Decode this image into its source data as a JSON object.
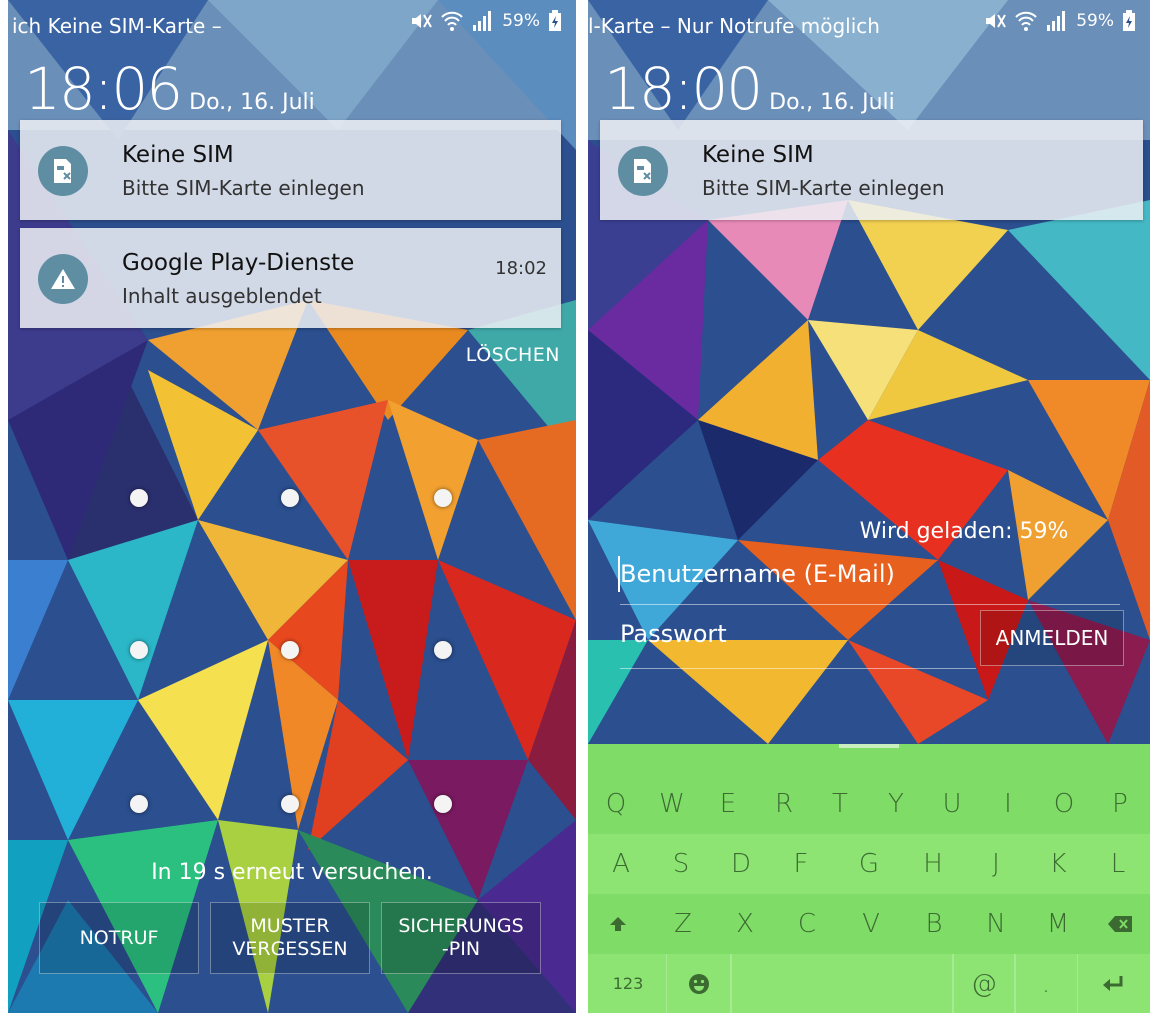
{
  "left_screen": {
    "status": {
      "carrier": "ich     Keine SIM-Karte –",
      "battery": "59%"
    },
    "clock": {
      "time": "18:06",
      "date": "Do., 16. Juli"
    },
    "notifications": [
      {
        "title": "Keine SIM",
        "text": "Bitte SIM-Karte einlegen",
        "time": ""
      },
      {
        "title": "Google Play-Dienste",
        "text": "Inhalt ausgeblendet",
        "time": "18:02"
      }
    ],
    "clear_label": "LÖSCHEN",
    "retry_message": "In 19 s erneut versuchen.",
    "buttons": {
      "emergency": "NOTRUF",
      "forgot_pattern": "MUSTER\nVERGESSEN",
      "backup_pin": "SICHERUNGS\n-PIN"
    }
  },
  "right_screen": {
    "status": {
      "carrier": "l-Karte – Nur Notrufe möglich",
      "battery": "59%"
    },
    "clock": {
      "time": "18:00",
      "date": "Do., 16. Juli"
    },
    "notifications": [
      {
        "title": "Keine SIM",
        "text": "Bitte SIM-Karte einlegen"
      }
    ],
    "charging_status": "Wird geladen: 59%",
    "login": {
      "username_placeholder": "Benutzername (E-Mail)",
      "password_placeholder": "Passwort",
      "login_button": "ANMELDEN"
    },
    "keyboard": {
      "row1": [
        "Q",
        "W",
        "E",
        "R",
        "T",
        "Y",
        "U",
        "I",
        "O",
        "P"
      ],
      "row2": [
        "A",
        "S",
        "D",
        "F",
        "G",
        "H",
        "J",
        "K",
        "L"
      ],
      "row3": [
        "Z",
        "X",
        "C",
        "V",
        "B",
        "N",
        "M"
      ],
      "row4": {
        "numbers": "123",
        "at": "@",
        "period": "."
      }
    }
  },
  "colors": {
    "keyboard_bg": "#7fdc66",
    "key_text": "#3c6b32",
    "notification_icon": "#5f8ea3"
  }
}
